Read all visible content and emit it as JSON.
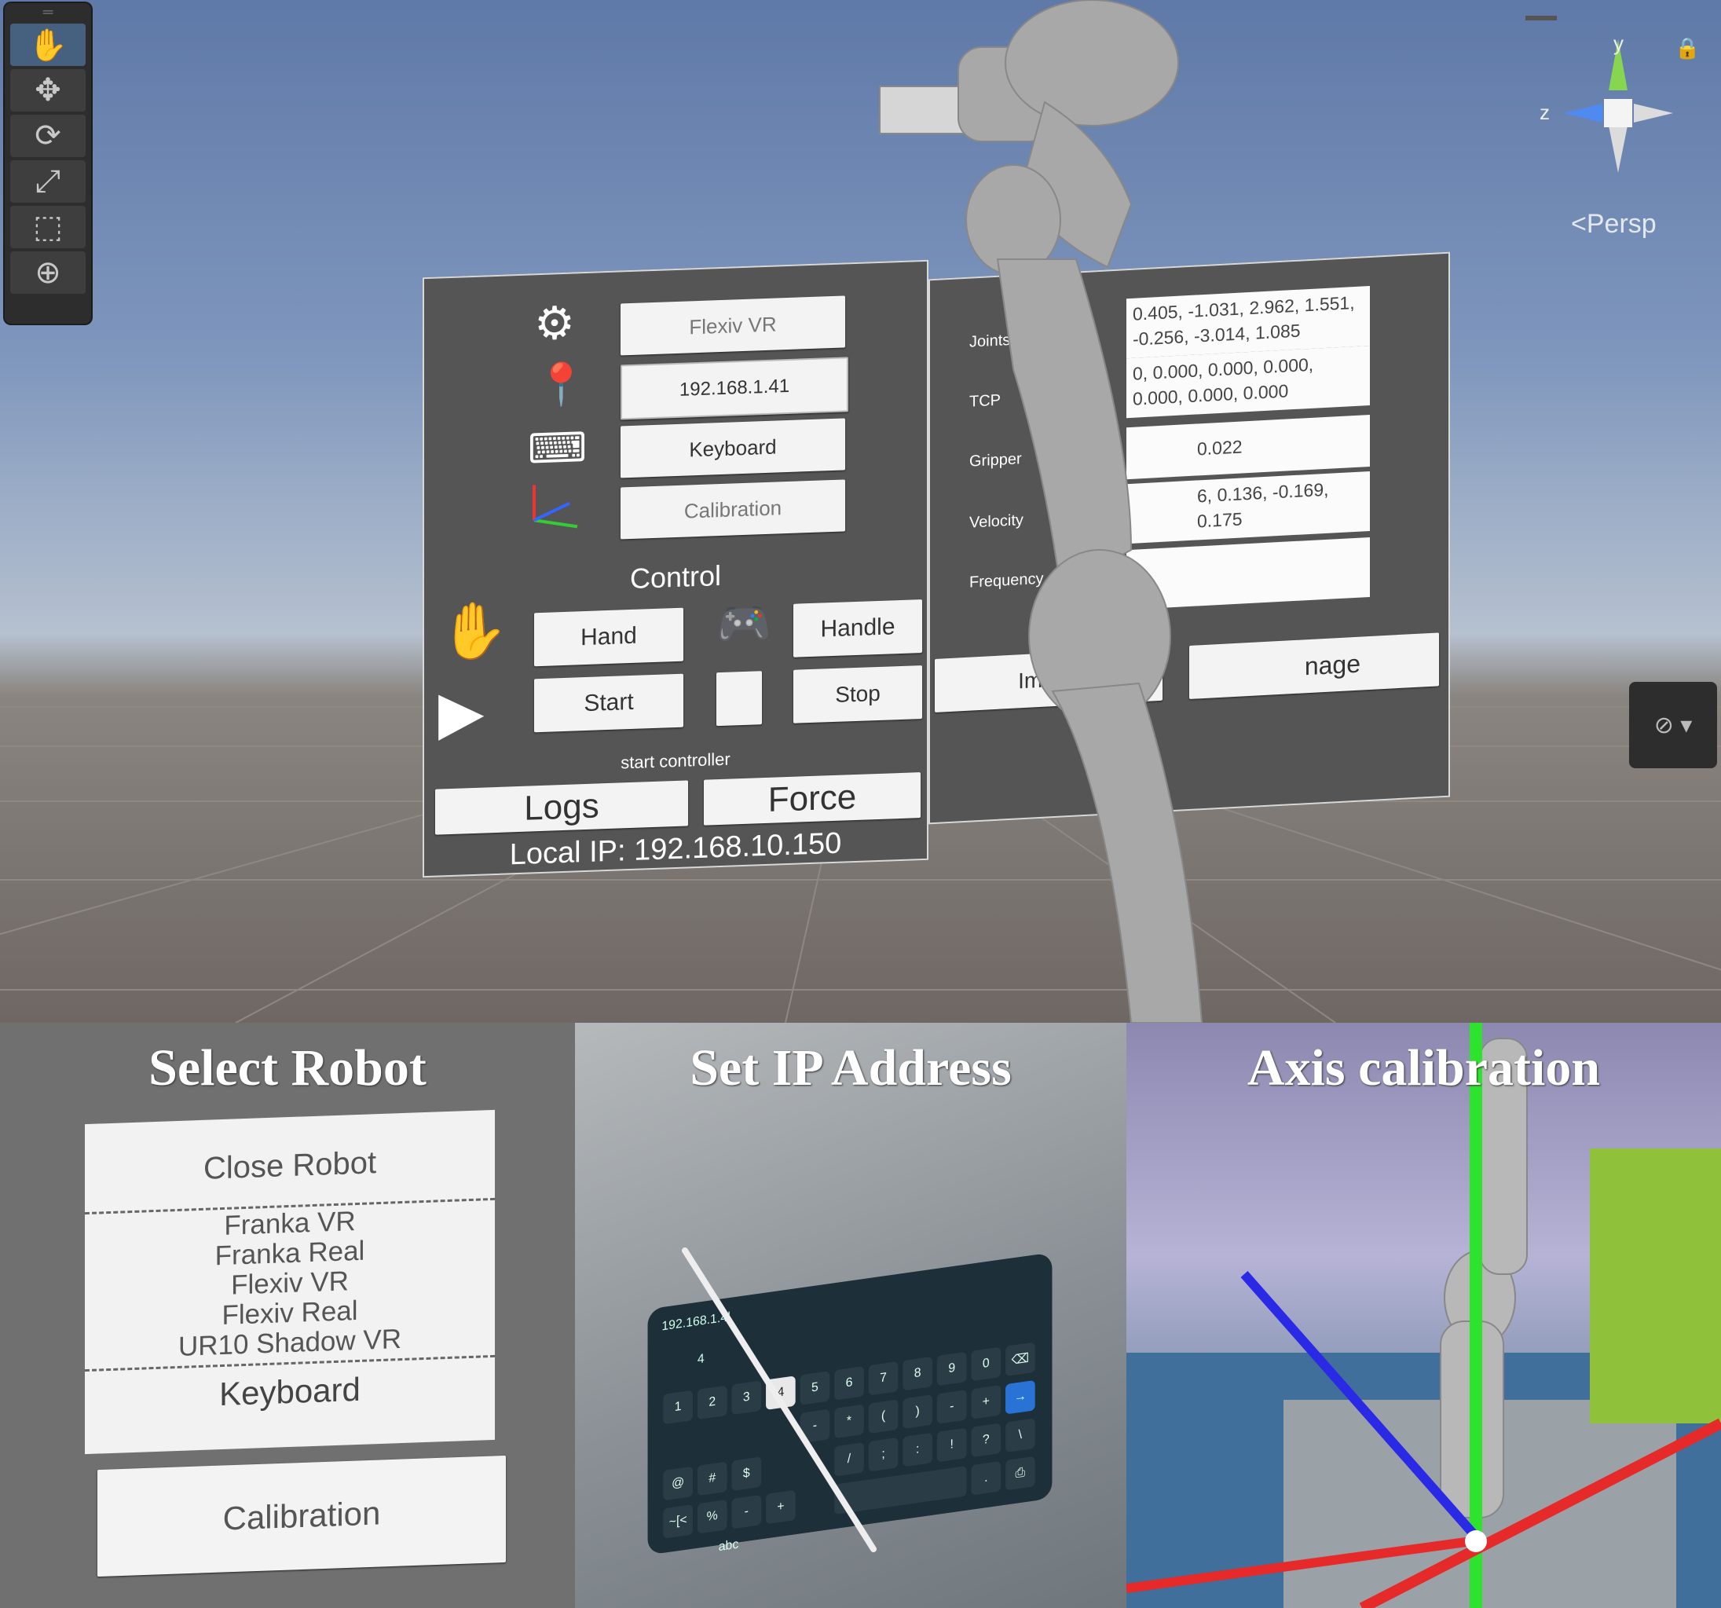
{
  "editor": {
    "toolbar": {
      "tools": [
        {
          "name": "hand-tool",
          "icon": "✋"
        },
        {
          "name": "move-tool",
          "icon": "✥"
        },
        {
          "name": "rotate-tool",
          "icon": "⟳"
        },
        {
          "name": "scale-tool",
          "icon": "⤢"
        },
        {
          "name": "rect-tool",
          "icon": "⬚"
        },
        {
          "name": "transform-tool",
          "icon": "⊕"
        }
      ]
    },
    "gizmo": {
      "y_label": "y",
      "z_label": "z",
      "view_label": "Persp"
    },
    "colors": {
      "sky_top": "#5f79a8",
      "ground": "#6e6764",
      "panel": "#555555",
      "accent_green": "#7fd34a",
      "accent_blue": "#4f8af0"
    }
  },
  "main_panel": {
    "robot_select": "Flexiv VR",
    "ip_field": "192.168.1.41",
    "keyboard_button": "Keyboard",
    "calibration_button": "Calibration",
    "control_heading": "Control",
    "hand_button": "Hand",
    "handle_button": "Handle",
    "start_button": "Start",
    "stop_button": "Stop",
    "start_controller_label": "start controller",
    "logs_button": "Logs",
    "force_button": "Force",
    "local_ip": "Local IP: 192.168.10.150"
  },
  "status_panel": {
    "rows": [
      {
        "label": "Joints",
        "value": "0.405, -1.031, 2.962, 1.551, -0.256, -3.014, 1.085"
      },
      {
        "label": "TCP",
        "value": "0, 0.000, 0.000, 0.000, 0.000, 0.000, 0.000"
      },
      {
        "label": "Gripper",
        "value": "0.022"
      },
      {
        "label": "Velocity",
        "value": "6, 0.136, -0.169, 0.175"
      },
      {
        "label": "Frequency",
        "value": ""
      }
    ],
    "image_button_left": "Image",
    "image_button_right": "nage"
  },
  "bottom": {
    "select_robot": {
      "caption": "Select Robot",
      "selected": "Close Robot",
      "options": [
        "Franka VR",
        "Franka Real",
        "Flexiv VR",
        "Flexiv Real",
        "UR10 Shadow VR"
      ],
      "keyboard_label": "Keyboard",
      "calibration_label": "Calibration"
    },
    "set_ip": {
      "caption": "Set IP Address",
      "input": "192.168.1.4|",
      "suggestion": "4",
      "row1": [
        "1",
        "2",
        "3",
        "4",
        "5",
        "6",
        "7",
        "8",
        "9",
        "0",
        "⌫"
      ],
      "row2": [
        "-",
        "*",
        "(",
        ")",
        "-",
        "+",
        "→"
      ],
      "row3": [
        "@",
        "#",
        "$",
        "/",
        ";",
        ":",
        "!",
        "?",
        "\\"
      ],
      "row4": [
        "~[<",
        "%",
        "-",
        "+",
        "/",
        ".",
        ",",
        "⎙"
      ],
      "abc": "abc"
    },
    "axis_calibration": {
      "caption": "Axis calibration"
    }
  }
}
